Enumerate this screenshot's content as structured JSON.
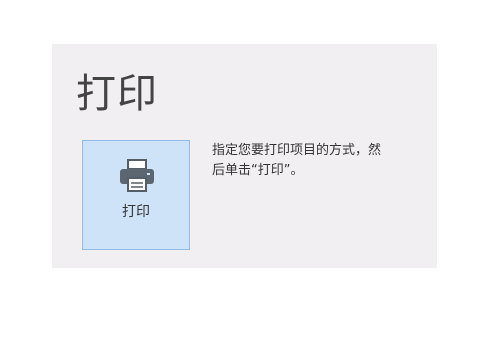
{
  "panel": {
    "title": "打印",
    "print_button": {
      "label": "打印",
      "icon": "printer-icon"
    },
    "description": "指定您要打印项目的方式，然后单击“打印”。"
  }
}
